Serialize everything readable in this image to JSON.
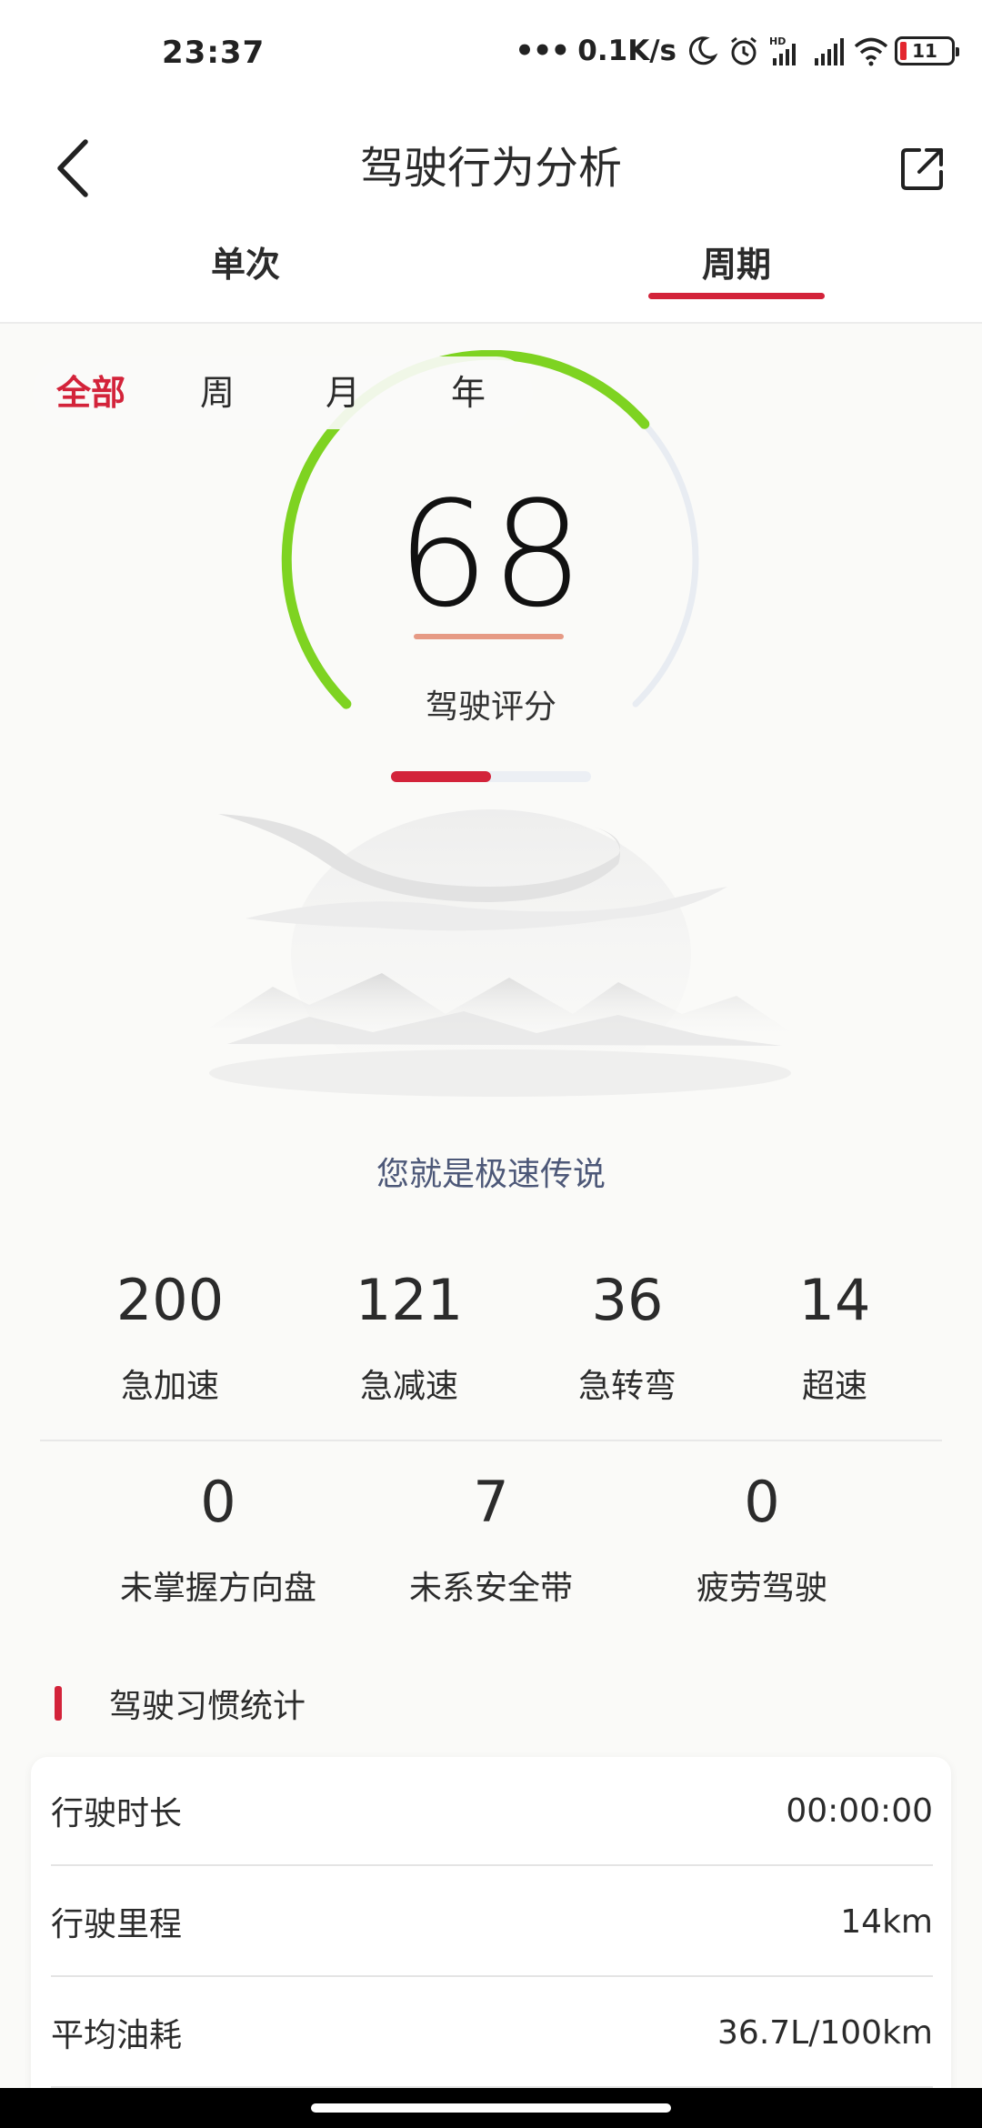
{
  "status_bar": {
    "time": "23:37",
    "dots": "•••",
    "net_speed": "0.1K/s",
    "battery_level": "11",
    "battery_color": "#e3262f",
    "icons": [
      "moon-icon",
      "alarm-icon",
      "hd-signal-icon",
      "signal-icon",
      "wifi-icon",
      "battery-icon"
    ]
  },
  "header": {
    "title": "驾驶行为分析",
    "back_icon": "chevron-left-icon",
    "share_icon": "share-icon"
  },
  "tabs": [
    {
      "label": "单次",
      "active": false
    },
    {
      "label": "周期",
      "active": true
    }
  ],
  "period_filter": [
    {
      "label": "全部",
      "active": true
    },
    {
      "label": "周",
      "active": false
    },
    {
      "label": "月",
      "active": false
    },
    {
      "label": "年",
      "active": false
    }
  ],
  "score": {
    "value": "68",
    "label": "驾驶评分",
    "gauge_fraction": 0.68,
    "gauge_color": "#7ed321",
    "track_color": "#e8ecf2",
    "page_progress_fraction": 0.5
  },
  "slogan": "您就是极速传说",
  "stats_row1": [
    {
      "value": "200",
      "label": "急加速"
    },
    {
      "value": "121",
      "label": "急减速"
    },
    {
      "value": "36",
      "label": "急转弯"
    },
    {
      "value": "14",
      "label": "超速"
    }
  ],
  "stats_row2": [
    {
      "value": "0",
      "label": "未掌握方向盘"
    },
    {
      "value": "7",
      "label": "未系安全带"
    },
    {
      "value": "0",
      "label": "疲劳驾驶"
    }
  ],
  "habits": {
    "title": "驾驶习惯统计",
    "rows": [
      {
        "label": "行驶时长",
        "value": "00:00:00"
      },
      {
        "label": "行驶里程",
        "value": "14km"
      },
      {
        "label": "平均油耗",
        "value": "36.7L/100km"
      }
    ]
  },
  "colors": {
    "accent": "#d3233a",
    "slogan": "#4d5878"
  }
}
